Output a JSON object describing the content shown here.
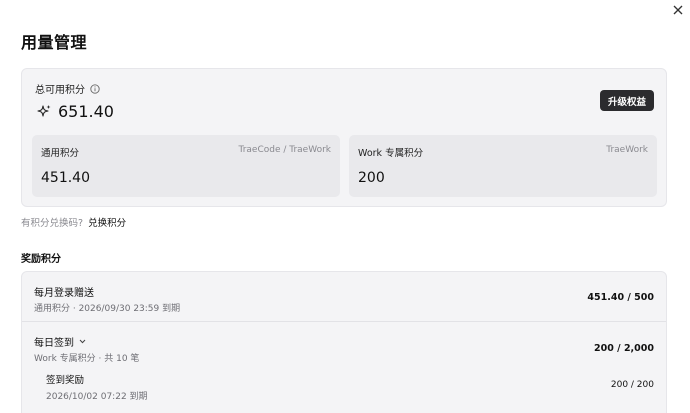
{
  "header": {
    "title": "用量管理",
    "close_icon": "close-icon"
  },
  "total": {
    "label": "总可用积分",
    "info_icon": "info-icon",
    "sparkle_icon": "sparkle-icon",
    "value": "651.40",
    "upgrade_label": "升级权益",
    "cards": [
      {
        "label": "通用积分",
        "tag": "TraeCode / TraeWork",
        "value": "451.40"
      },
      {
        "label": "Work 专属积分",
        "tag": "TraeWork",
        "value": "200"
      }
    ]
  },
  "redeem": {
    "prompt": "有积分兑换码?",
    "link": "兑换积分"
  },
  "rewards": {
    "section_title": "奖励积分",
    "items": [
      {
        "title": "每月登录赠送",
        "subtitle": "通用积分 · 2026/09/30 23:59 到期",
        "value": "451.40 / 500"
      },
      {
        "title": "每日签到",
        "subtitle": "Work 专属积分 · 共 10 笔",
        "value": "200 / 2,000",
        "chevron_icon": "chevron-down-icon"
      },
      {
        "title": "签到奖励",
        "subtitle": "2026/10/02 07:22 到期",
        "value": "200 / 200"
      }
    ]
  },
  "colors": {
    "card_bg": "#f4f4f6",
    "sub_card_bg": "#e9e9ec",
    "button_bg": "#2b2b2e",
    "muted_text": "#8a8a90"
  }
}
